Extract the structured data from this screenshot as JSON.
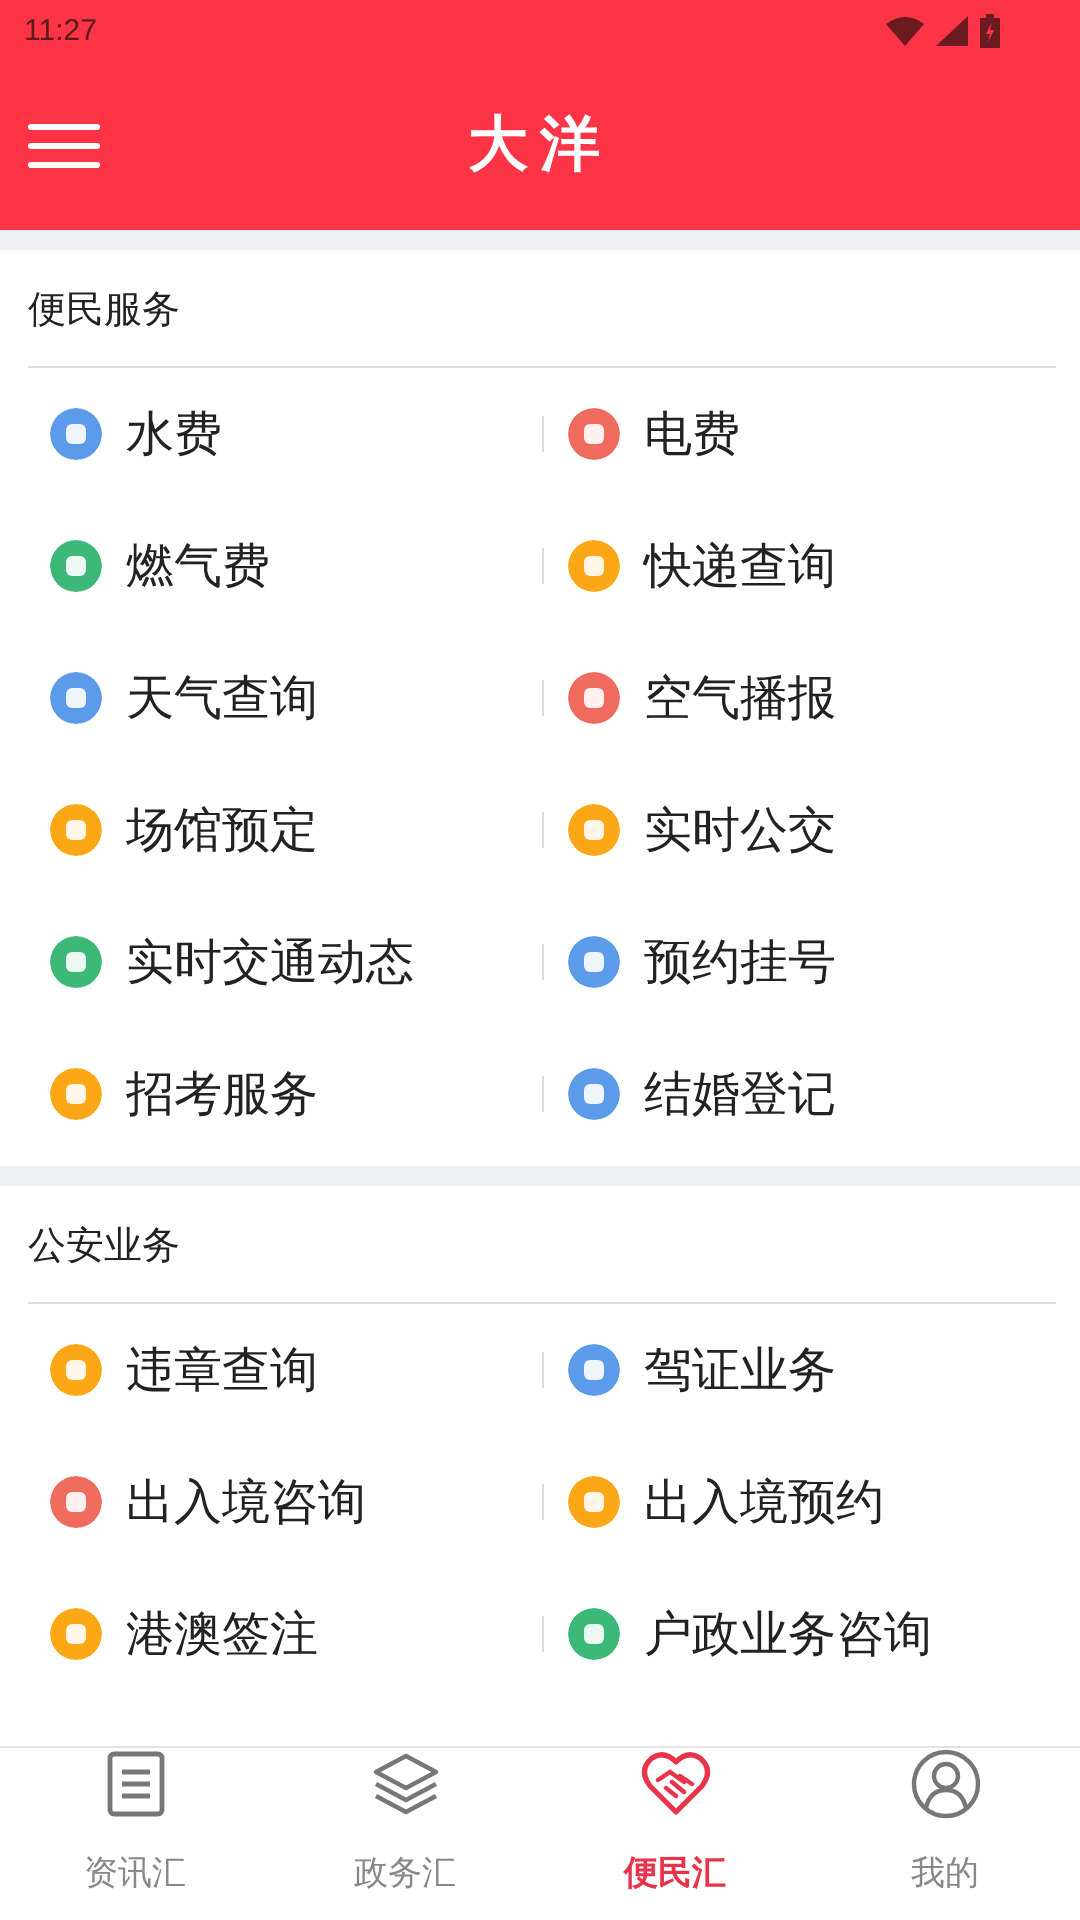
{
  "status_bar": {
    "time": "11:27"
  },
  "app_bar": {
    "title": "大洋"
  },
  "sections": [
    {
      "title": "便民服务",
      "items": [
        {
          "label": "水费",
          "color": "#5b9bea"
        },
        {
          "label": "电费",
          "color": "#ee6b5e"
        },
        {
          "label": "燃气费",
          "color": "#3cb878"
        },
        {
          "label": "快递查询",
          "color": "#fca716"
        },
        {
          "label": "天气查询",
          "color": "#5b9bea"
        },
        {
          "label": "空气播报",
          "color": "#ee6b5e"
        },
        {
          "label": "场馆预定",
          "color": "#fca716"
        },
        {
          "label": "实时公交",
          "color": "#fca716"
        },
        {
          "label": "实时交通动态",
          "color": "#3cb878"
        },
        {
          "label": "预约挂号",
          "color": "#5b9bea"
        },
        {
          "label": "招考服务",
          "color": "#fca716"
        },
        {
          "label": "结婚登记",
          "color": "#5b9bea"
        }
      ]
    },
    {
      "title": "公安业务",
      "items": [
        {
          "label": "违章查询",
          "color": "#fca716"
        },
        {
          "label": "驾证业务",
          "color": "#5b9bea"
        },
        {
          "label": "出入境咨询",
          "color": "#ee6b5e"
        },
        {
          "label": "出入境预约",
          "color": "#fca716"
        },
        {
          "label": "港澳签注",
          "color": "#fca716"
        },
        {
          "label": "户政业务咨询",
          "color": "#3cb878"
        }
      ]
    }
  ],
  "tabs": [
    {
      "label": "资讯汇",
      "selected": false
    },
    {
      "label": "政务汇",
      "selected": false
    },
    {
      "label": "便民汇",
      "selected": true
    },
    {
      "label": "我的",
      "selected": false
    }
  ]
}
